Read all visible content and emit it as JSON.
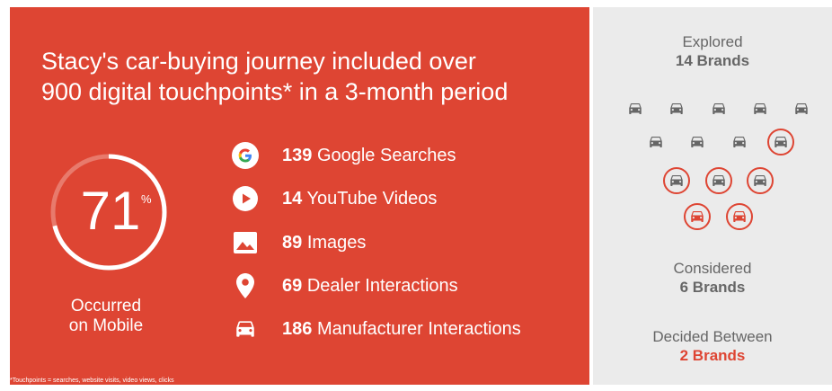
{
  "headline": {
    "line1": "Stacy's car-buying journey included over",
    "line2": "900 digital touchpoints* in a 3-month period"
  },
  "mobile": {
    "percent": "71",
    "percent_sign": "%",
    "fraction": 0.71,
    "caption_line1": "Occurred",
    "caption_line2": "on Mobile"
  },
  "stats": [
    {
      "icon": "google-icon",
      "count": "139",
      "label": "Google Searches"
    },
    {
      "icon": "youtube-play-icon",
      "count": "14",
      "label": "YouTube Videos"
    },
    {
      "icon": "image-icon",
      "count": "89",
      "label": "Images"
    },
    {
      "icon": "location-pin-icon",
      "count": "69",
      "label": "Dealer Interactions"
    },
    {
      "icon": "car-icon",
      "count": "186",
      "label": "Manufacturer Interactions"
    }
  ],
  "footnote": "*Touchpoints = searches, website visits, video views, clicks",
  "brands": {
    "explored_label": "Explored",
    "explored_value": "14 Brands",
    "considered_label": "Considered",
    "considered_value": "6 Brands",
    "decided_label": "Decided Between",
    "decided_value": "2 Brands"
  },
  "colors": {
    "red": "#de4533",
    "gray_panel": "#ebebeb",
    "car_gray": "#666666"
  }
}
